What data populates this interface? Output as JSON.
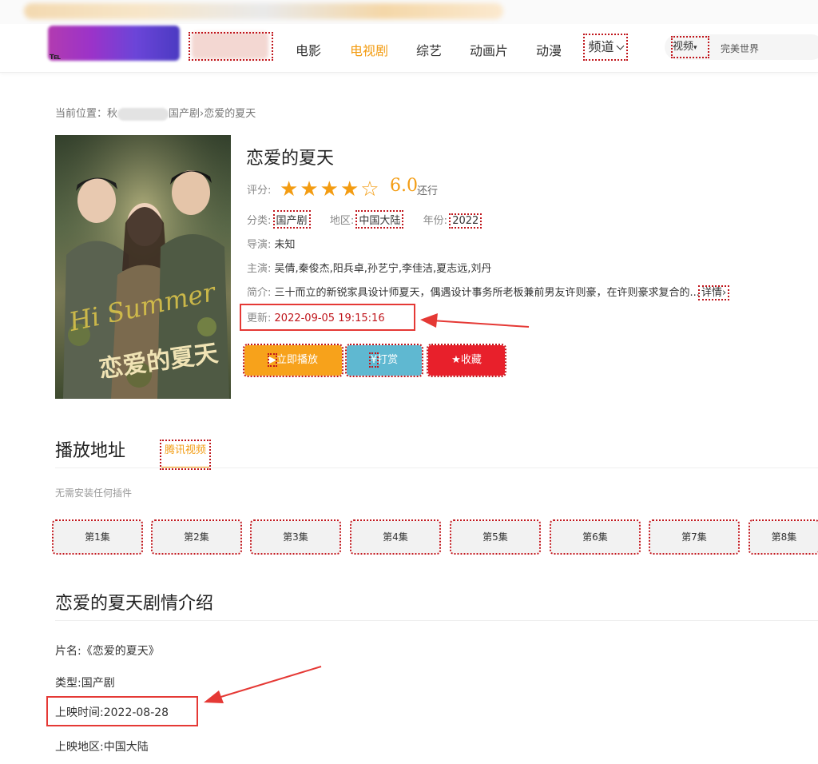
{
  "nav": {
    "items": [
      "电影",
      "电视剧",
      "综艺",
      "动画片",
      "动漫"
    ],
    "active_index": 1,
    "channel_label": "频道"
  },
  "search": {
    "category": "视频",
    "value": "完美世界"
  },
  "breadcrumb": {
    "prefix": "当前位置：",
    "home": "秋",
    "category": "国产剧",
    "sep": "›",
    "current": "恋爱的夏天"
  },
  "detail": {
    "title": "恋爱的夏天",
    "rating_label": "评分:",
    "rating": 4,
    "rating_max": 5,
    "score": "6.0",
    "score_text": "还行",
    "genre_label": "分类:",
    "genre": "国产剧",
    "region_label": "地区:",
    "region": "中国大陆",
    "year_label": "年份:",
    "year": "2022",
    "director_label": "导演:",
    "director": "未知",
    "cast_label": "主演:",
    "cast": "吴倩,秦俊杰,阳兵卓,孙艺宁,李佳洁,夏志远,刘丹",
    "summary_label": "简介:",
    "summary": "三十而立的新锐家具设计师夏天，偶遇设计事务所老板兼前男友许则豪，在许则豪求复合的...",
    "more": "详情",
    "update_label": "更新:",
    "update": "2022-09-05 19:15:16"
  },
  "poster": {
    "en_title": "Hi Summer",
    "cn_title": "恋爱的夏天"
  },
  "actions": {
    "play": "立即播放",
    "tip": "打赏",
    "fav": "收藏"
  },
  "play_section": {
    "title": "播放地址",
    "source_tab": "腾讯视频",
    "hint": "无需安装任何插件",
    "episodes": [
      "第1集",
      "第2集",
      "第3集",
      "第4集",
      "第5集",
      "第6集",
      "第7集",
      "第8集"
    ]
  },
  "plot_section": {
    "title": "恋爱的夏天剧情介绍",
    "name_line": "片名:《恋爱的夏天》",
    "type_line": "类型:国产剧",
    "release_line": "上映时间:2022-08-28",
    "region_line": "上映地区:中国大陆"
  },
  "colors": {
    "accent": "#f39c12",
    "play": "#f7a21b",
    "tip": "#5fb8d1",
    "fav": "#e8202b",
    "highlight": "#e53935"
  }
}
